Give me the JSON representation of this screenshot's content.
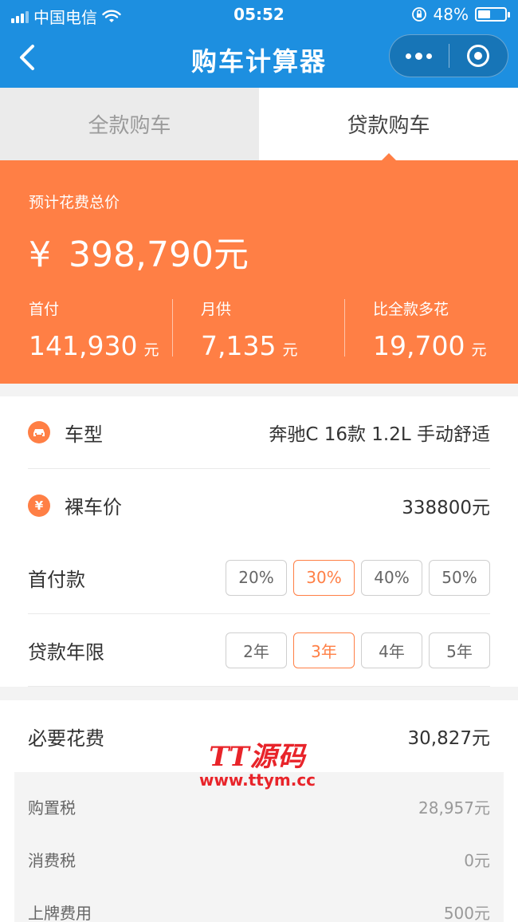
{
  "status": {
    "carrier": "中国电信",
    "time": "05:52",
    "battery": "48%",
    "battery_level": 0.48
  },
  "nav": {
    "title": "购车计算器"
  },
  "tabs": [
    {
      "label": "全款购车",
      "active": false
    },
    {
      "label": "贷款购车",
      "active": true
    }
  ],
  "summary": {
    "label": "预计花费总价",
    "currency": "¥",
    "total": "398,790元",
    "down_payment": {
      "label": "首付",
      "value": "141,930",
      "unit": "元"
    },
    "monthly": {
      "label": "月供",
      "value": "7,135",
      "unit": "元"
    },
    "extra": {
      "label": "比全款多花",
      "value": "19,700",
      "unit": "元"
    }
  },
  "form": {
    "model": {
      "label": "车型",
      "value": "奔驰C 16款 1.2L 手动舒适"
    },
    "price": {
      "label": "裸车价",
      "value": "338800元"
    },
    "down": {
      "label": "首付款",
      "options": [
        "20%",
        "30%",
        "40%",
        "50%"
      ],
      "selected": "30%"
    },
    "term": {
      "label": "贷款年限",
      "options": [
        "2年",
        "3年",
        "4年",
        "5年"
      ],
      "selected": "3年"
    }
  },
  "fees": {
    "label": "必要花费",
    "value": "30,827元",
    "items": [
      {
        "label": "购置税",
        "value": "28,957元"
      },
      {
        "label": "消费税",
        "value": "0元"
      },
      {
        "label": "上牌费用",
        "value": "500元"
      }
    ]
  },
  "watermark": {
    "line1": "TT源码",
    "line2": "www.ttym.cc"
  },
  "colors": {
    "primary": "#1d8fe0",
    "accent": "#ff7f45"
  }
}
